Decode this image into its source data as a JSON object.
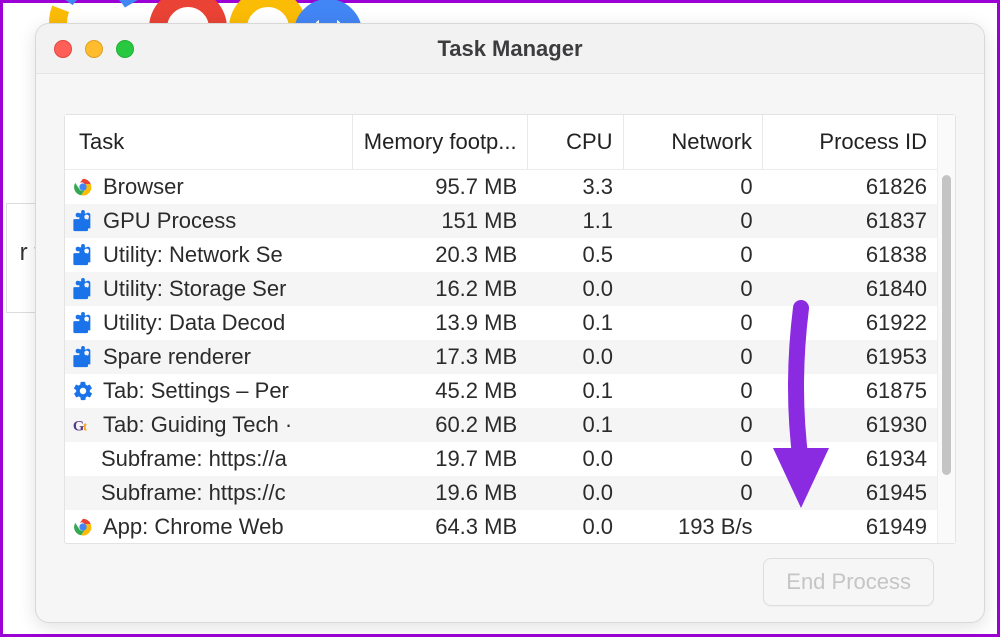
{
  "window": {
    "title": "Task Manager"
  },
  "columns": {
    "task": "Task",
    "memory": "Memory footp...",
    "cpu": "CPU",
    "network": "Network",
    "pid": "Process ID"
  },
  "rows": [
    {
      "icon": "chrome",
      "task": "Browser",
      "memory": "95.7 MB",
      "cpu": "3.3",
      "network": "0",
      "pid": "61826",
      "indent": false
    },
    {
      "icon": "puzzle",
      "task": "GPU Process",
      "memory": "151 MB",
      "cpu": "1.1",
      "network": "0",
      "pid": "61837",
      "indent": false
    },
    {
      "icon": "puzzle",
      "task": "Utility: Network Se",
      "memory": "20.3 MB",
      "cpu": "0.5",
      "network": "0",
      "pid": "61838",
      "indent": false
    },
    {
      "icon": "puzzle",
      "task": "Utility: Storage Ser",
      "memory": "16.2 MB",
      "cpu": "0.0",
      "network": "0",
      "pid": "61840",
      "indent": false
    },
    {
      "icon": "puzzle",
      "task": "Utility: Data Decod",
      "memory": "13.9 MB",
      "cpu": "0.1",
      "network": "0",
      "pid": "61922",
      "indent": false
    },
    {
      "icon": "puzzle",
      "task": "Spare renderer",
      "memory": "17.3 MB",
      "cpu": "0.0",
      "network": "0",
      "pid": "61953",
      "indent": false
    },
    {
      "icon": "gear",
      "task": "Tab: Settings – Per",
      "memory": "45.2 MB",
      "cpu": "0.1",
      "network": "0",
      "pid": "61875",
      "indent": false
    },
    {
      "icon": "gt",
      "task": "Tab: Guiding Tech ·",
      "memory": "60.2 MB",
      "cpu": "0.1",
      "network": "0",
      "pid": "61930",
      "indent": false
    },
    {
      "icon": "none",
      "task": "Subframe: https://a",
      "memory": "19.7 MB",
      "cpu": "0.0",
      "network": "0",
      "pid": "61934",
      "indent": true
    },
    {
      "icon": "none",
      "task": "Subframe: https://c",
      "memory": "19.6 MB",
      "cpu": "0.0",
      "network": "0",
      "pid": "61945",
      "indent": true
    },
    {
      "icon": "chrome-partial",
      "task": "App: Chrome Web",
      "memory": "64.3 MB",
      "cpu": "0.0",
      "network": "193 B/s",
      "pid": "61949",
      "indent": false
    }
  ],
  "footer": {
    "end_process": "End Process"
  },
  "background": {
    "text_fragment": "r t"
  }
}
